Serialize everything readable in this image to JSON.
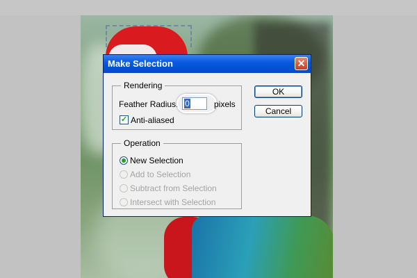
{
  "dialog": {
    "title": "Make Selection",
    "close_glyph": "✕",
    "rendering": {
      "legend": "Rendering",
      "feather_label": "Feather Radius:",
      "feather_value": "0",
      "units": "pixels",
      "anti_aliased_label": "Anti-aliased",
      "anti_aliased_checked": true
    },
    "operation": {
      "legend": "Operation",
      "options": [
        {
          "label": "New Selection",
          "checked": true,
          "enabled": true
        },
        {
          "label": "Add to Selection",
          "checked": false,
          "enabled": false
        },
        {
          "label": "Subtract from Selection",
          "checked": false,
          "enabled": false
        },
        {
          "label": "Intersect with Selection",
          "checked": false,
          "enabled": false
        }
      ]
    },
    "buttons": {
      "ok": "OK",
      "cancel": "Cancel"
    }
  },
  "icons": {
    "close": "close-icon",
    "check": "check-icon"
  },
  "colors": {
    "titlebar": "#0a5be0",
    "dialog_bg": "#f0f0f0",
    "check_green": "#21a121"
  }
}
